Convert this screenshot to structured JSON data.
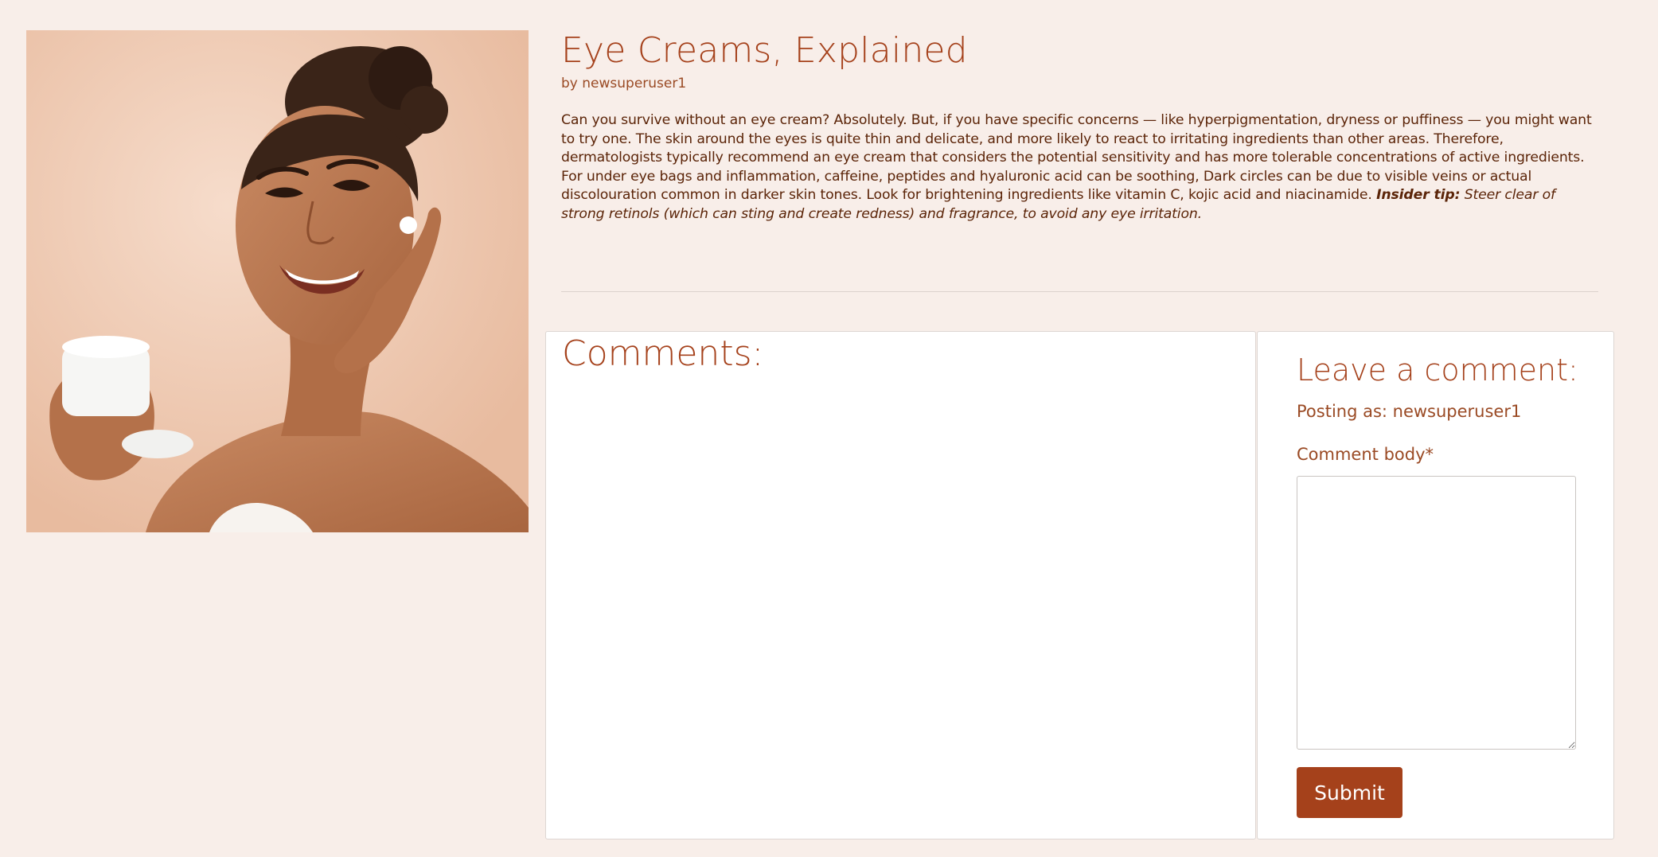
{
  "article": {
    "title": "Eye Creams, Explained",
    "byline": "by newsuperuser1",
    "paragraph1": "Can you survive without an eye cream? Absolutely. But, if you have specific concerns — like hyperpigmentation, dryness or puffiness — you might want to try one. The skin around the eyes is quite thin and delicate, and more likely to react to irritating ingredients than other areas. Therefore, dermatologists typically recommend an eye cream that considers the potential sensitivity and has more tolerable concentrations of active ingredients.",
    "paragraph2": "For under eye bags and inflammation, caffeine, peptides and hyaluronic acid can be soothing, Dark circles can be due to visible veins or actual discolouration common in darker skin tones. Look for brightening ingredients like vitamin C, kojic acid and niacinamide.",
    "tip_label": "Insider tip:",
    "tip_text": "Steer clear of strong retinols (which can sting and create redness) and fragrance, to avoid any eye irritation."
  },
  "comments": {
    "heading": "Comments:"
  },
  "comment_form": {
    "heading": "Leave a comment:",
    "posting_as": "Posting as: newsuperuser1",
    "body_label": "Comment body*",
    "body_value": "",
    "submit_label": "Submit"
  },
  "colors": {
    "page_background": "#f8eee9",
    "accent": "#a5411b",
    "body_text": "#5b2408"
  }
}
